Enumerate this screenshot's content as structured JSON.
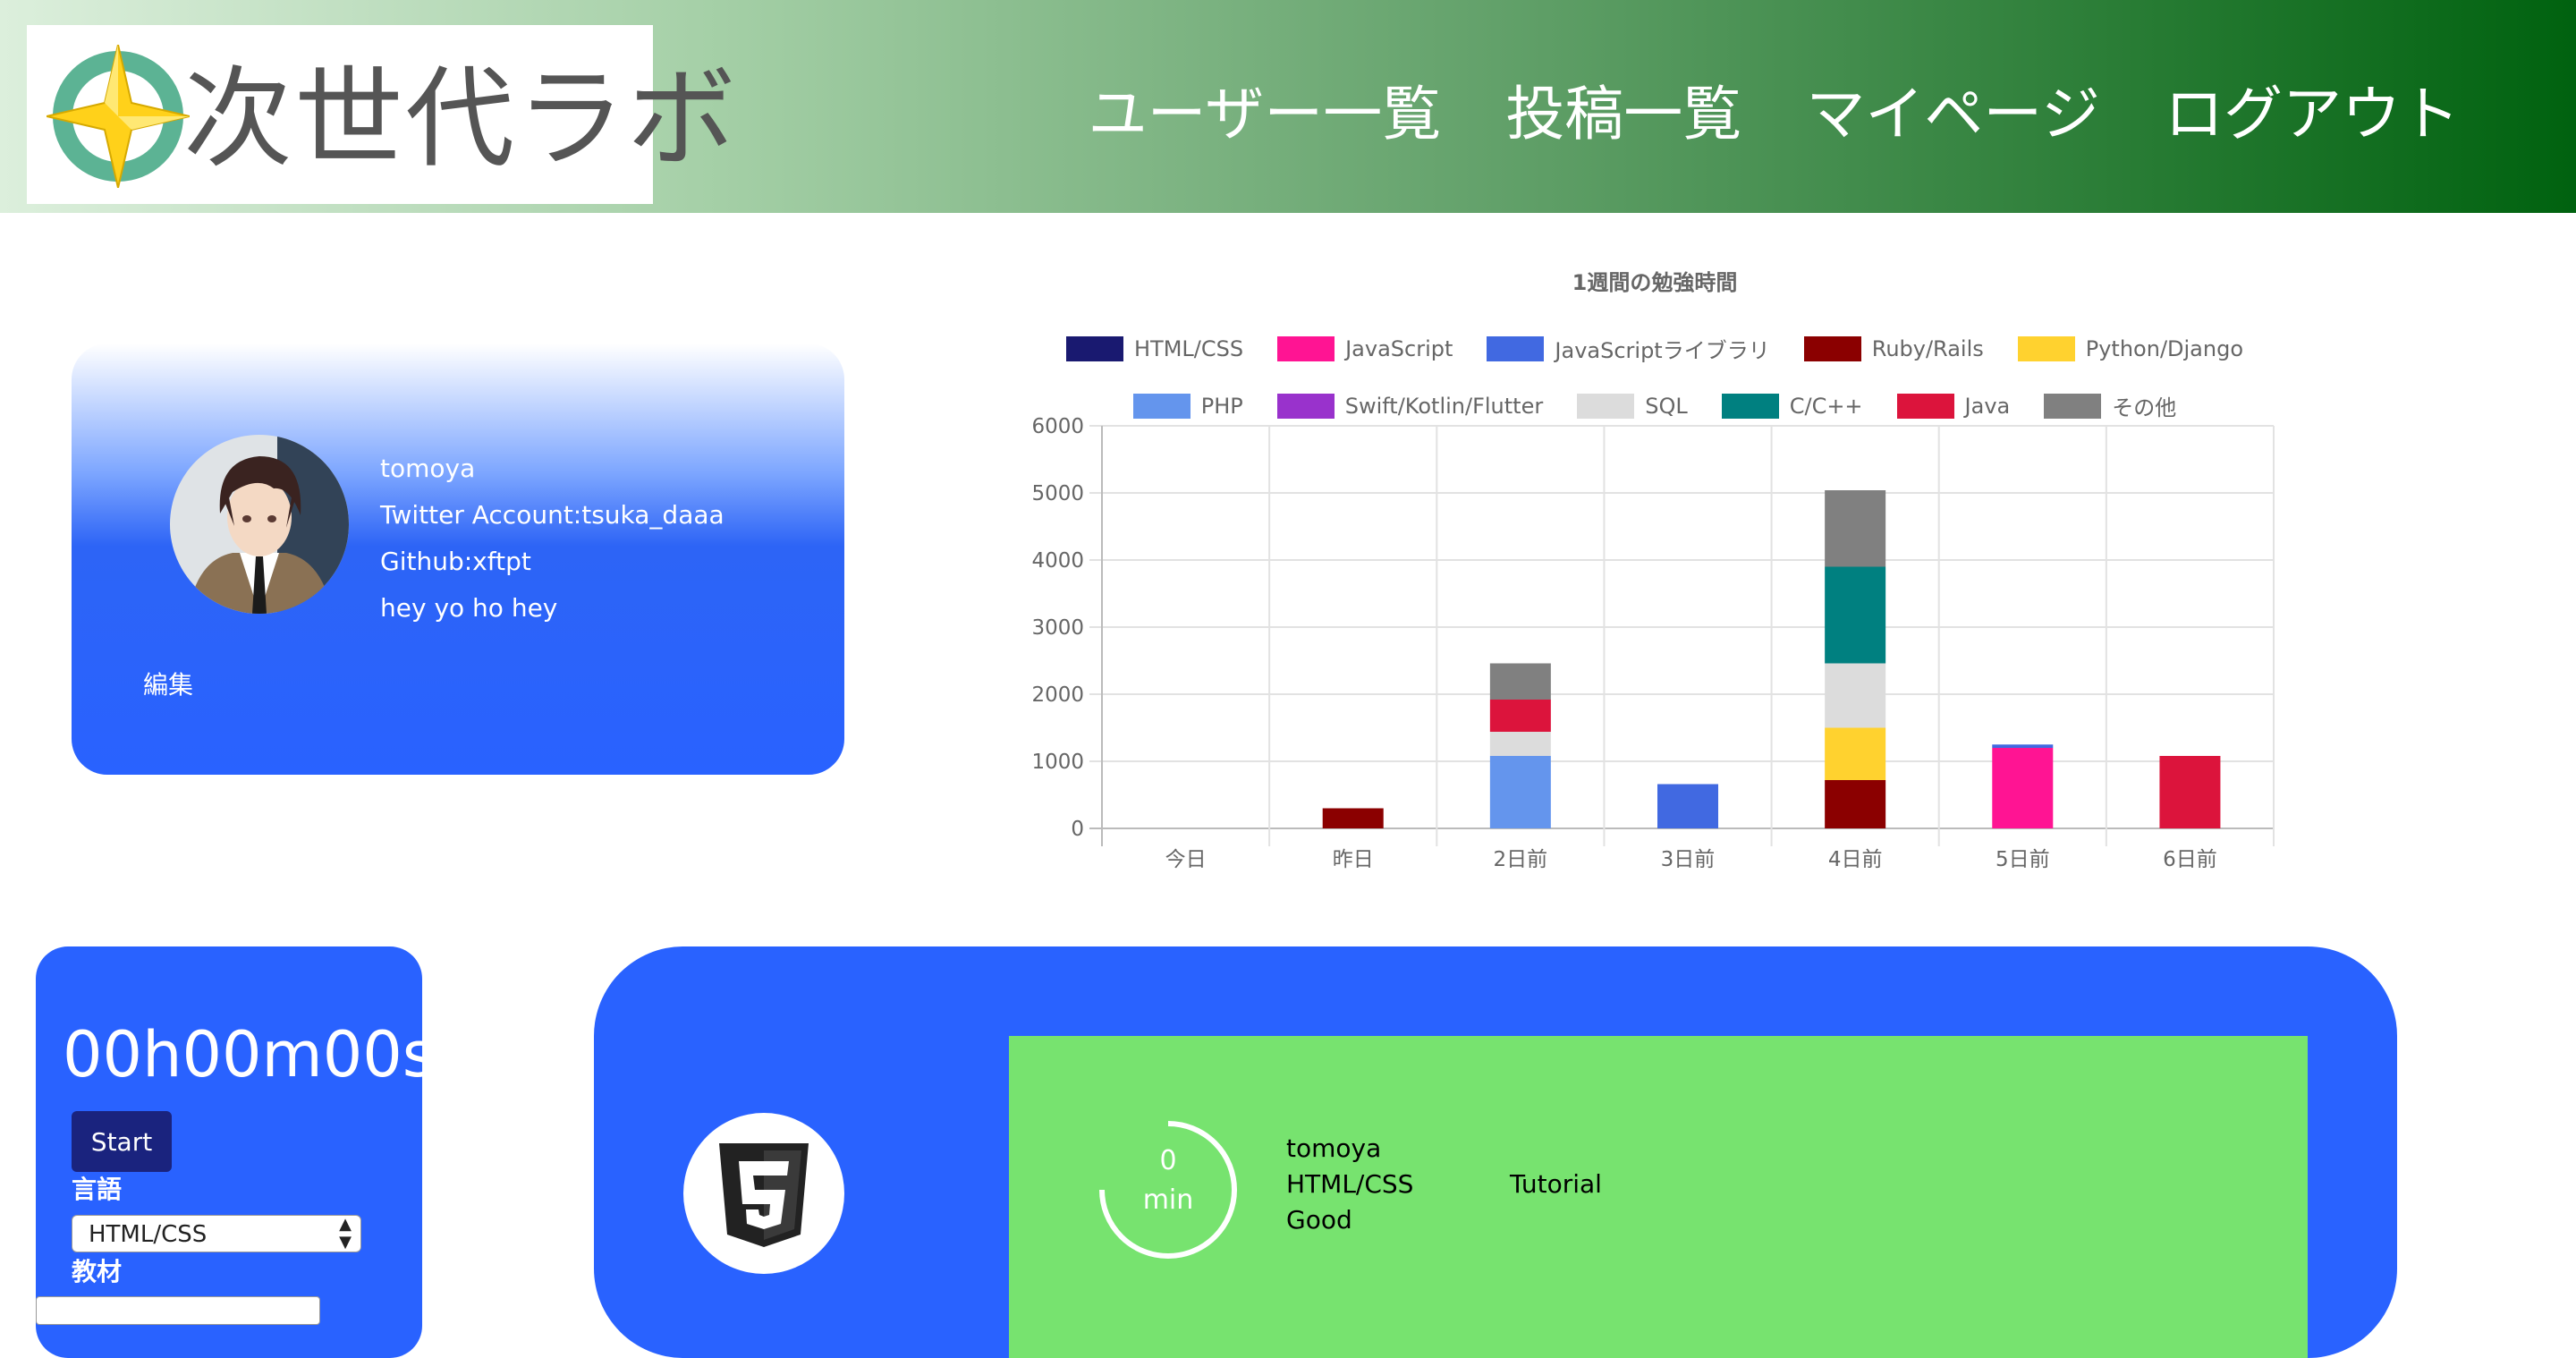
{
  "header": {
    "logo_text": "次世代ラボ",
    "nav": [
      "ユーザー一覧",
      "投稿一覧",
      "マイページ",
      "ログアウト"
    ]
  },
  "profile": {
    "name": "tomoya",
    "twitter": "Twitter Account:tsuka_daaa",
    "github": "Github:xftpt",
    "bio": "hey yo ho hey",
    "edit_label": "編集"
  },
  "timer": {
    "display": "00h00m00s",
    "start_label": "Start",
    "language_label": "言語",
    "language_selected": "HTML/CSS",
    "material_label": "教材"
  },
  "post": {
    "minutes": "0",
    "minutes_unit": "min",
    "user": "tomoya",
    "language": "HTML/CSS",
    "material": "Tutorial",
    "comment": "Good",
    "icon": "html5-icon"
  },
  "colors": {
    "header_end": "#00620f",
    "card_blue": "#2962ff",
    "post_green": "#77e36f",
    "start_button": "#1a237e"
  },
  "chart_data": {
    "type": "bar",
    "stacked": true,
    "title": "1週間の勉強時間",
    "categories": [
      "今日",
      "昨日",
      "2日前",
      "3日前",
      "4日前",
      "5日前",
      "6日前"
    ],
    "ylim": [
      0,
      6000
    ],
    "yticks": [
      0,
      1000,
      2000,
      3000,
      4000,
      5000,
      6000
    ],
    "grid": true,
    "legend_position": "top",
    "series": [
      {
        "name": "HTML/CSS",
        "color": "#191970",
        "values": [
          0,
          0,
          0,
          0,
          0,
          0,
          0
        ]
      },
      {
        "name": "JavaScript",
        "color": "#ff1493",
        "values": [
          0,
          0,
          0,
          0,
          0,
          1200,
          0
        ]
      },
      {
        "name": "JavaScriptライブラリ",
        "color": "#4169e1",
        "values": [
          0,
          0,
          0,
          660,
          0,
          50,
          0
        ]
      },
      {
        "name": "Ruby/Rails",
        "color": "#8b0000",
        "values": [
          0,
          300,
          0,
          0,
          720,
          0,
          0
        ]
      },
      {
        "name": "Python/Django",
        "color": "#ffd22f",
        "values": [
          0,
          0,
          0,
          0,
          780,
          0,
          0
        ]
      },
      {
        "name": "PHP",
        "color": "#6495ed",
        "values": [
          0,
          0,
          1080,
          0,
          0,
          0,
          0
        ]
      },
      {
        "name": "Swift/Kotlin/Flutter",
        "color": "#9932cc",
        "values": [
          0,
          0,
          0,
          0,
          0,
          0,
          0
        ]
      },
      {
        "name": "SQL",
        "color": "#dcdcdc",
        "values": [
          0,
          0,
          360,
          0,
          960,
          0,
          0
        ]
      },
      {
        "name": "C/C++",
        "color": "#008080",
        "values": [
          0,
          0,
          0,
          0,
          1440,
          0,
          0
        ]
      },
      {
        "name": "Java",
        "color": "#dc143c",
        "values": [
          0,
          0,
          480,
          0,
          0,
          0,
          1080
        ]
      },
      {
        "name": "その他",
        "color": "#808080",
        "values": [
          0,
          0,
          540,
          0,
          1140,
          0,
          0
        ]
      }
    ]
  }
}
